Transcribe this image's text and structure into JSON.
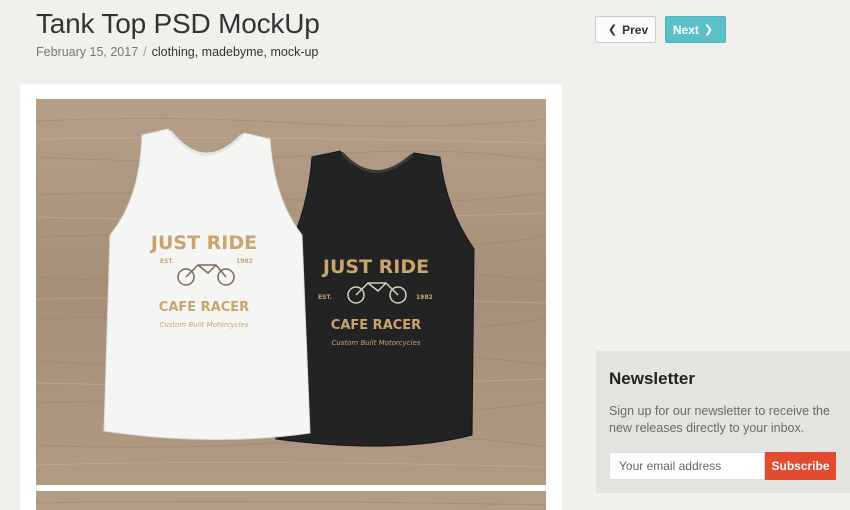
{
  "post": {
    "title": "Tank Top PSD MockUp",
    "date": "February 15, 2017",
    "separator": "/",
    "tags": "clothing, madebyme, mock-up"
  },
  "pager": {
    "prev_label": "Prev",
    "next_label": "Next"
  },
  "mockup": {
    "graphic_line1": "JUST RIDE",
    "graphic_est_left": "EST.",
    "graphic_est_right": "1982",
    "graphic_line2": "CAFE RACER",
    "graphic_line3": "Custom Built Motorcycles",
    "colors": {
      "wood": "#a8927c",
      "white_shirt": "#f4f4f2",
      "black_shirt": "#222222",
      "print_gold": "#c9a56d"
    }
  },
  "newsletter": {
    "heading": "Newsletter",
    "text": "Sign up for our newsletter to receive the new releases directly to your inbox.",
    "email_placeholder": "Your email address",
    "subscribe_label": "Subscribe"
  },
  "colors": {
    "accent_next": "#5bc0c8",
    "subscribe": "#e34a2f",
    "background": "#f2f0ed"
  }
}
